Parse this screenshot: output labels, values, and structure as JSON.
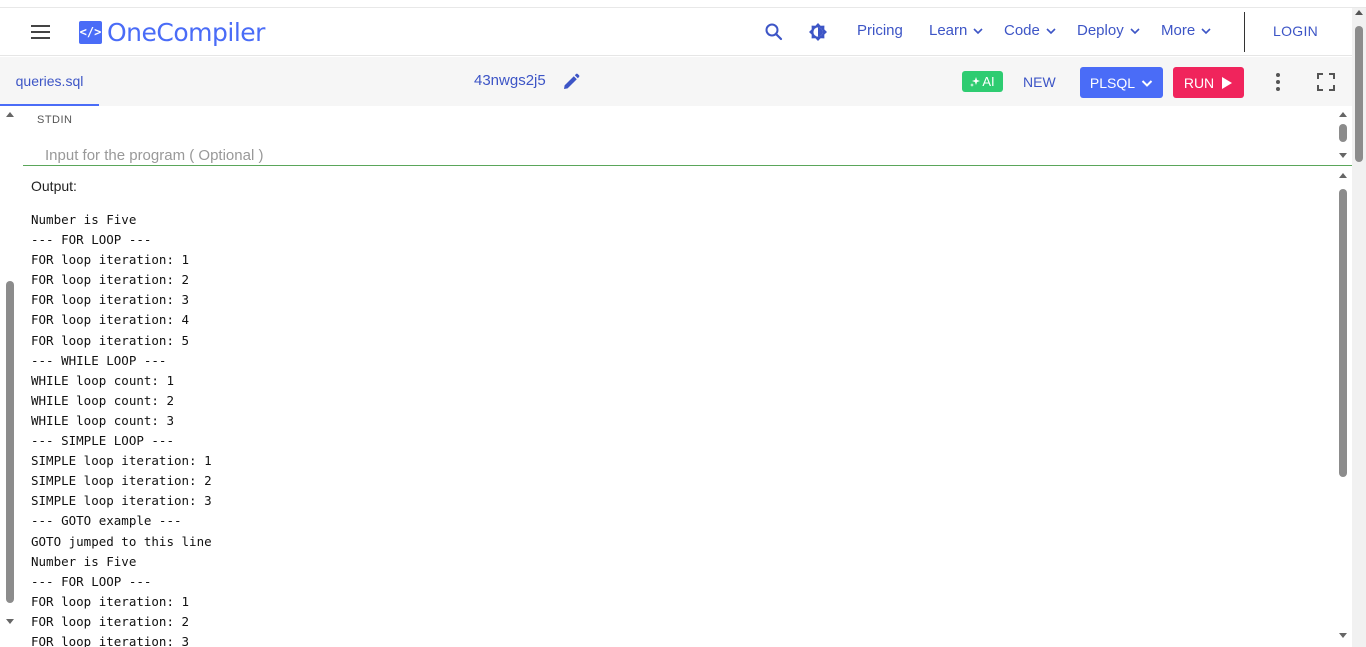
{
  "nav": {
    "logo_mark": "</>",
    "logo_text": "OneCompiler",
    "links": [
      "Pricing",
      "Learn",
      "Code",
      "Deploy",
      "More"
    ],
    "login": "LOGIN",
    "accent": "#4a6cf7",
    "icons": [
      "menu-icon",
      "search-icon",
      "theme-toggle-icon"
    ]
  },
  "toolbar": {
    "file_tab": "queries.sql",
    "code_id": "43nwgs2j5",
    "ai_label": "AI",
    "new_label": "NEW",
    "language": "PLSQL",
    "run_label": "RUN",
    "ai_color": "#2ecc71",
    "run_color": "#f0245c"
  },
  "stdin": {
    "label": "STDIN",
    "placeholder": "Input for the program ( Optional )"
  },
  "output": {
    "label": "Output:",
    "lines": [
      "Number is Five",
      "--- FOR LOOP ---",
      "FOR loop iteration: 1",
      "FOR loop iteration: 2",
      "FOR loop iteration: 3",
      "FOR loop iteration: 4",
      "FOR loop iteration: 5",
      "--- WHILE LOOP ---",
      "WHILE loop count: 1",
      "WHILE loop count: 2",
      "WHILE loop count: 3",
      "--- SIMPLE LOOP ---",
      "SIMPLE loop iteration: 1",
      "SIMPLE loop iteration: 2",
      "SIMPLE loop iteration: 3",
      "--- GOTO example ---",
      "GOTO jumped to this line",
      "Number is Five",
      "--- FOR LOOP ---",
      "FOR loop iteration: 1",
      "FOR loop iteration: 2",
      "FOR loop iteration: 3"
    ]
  }
}
